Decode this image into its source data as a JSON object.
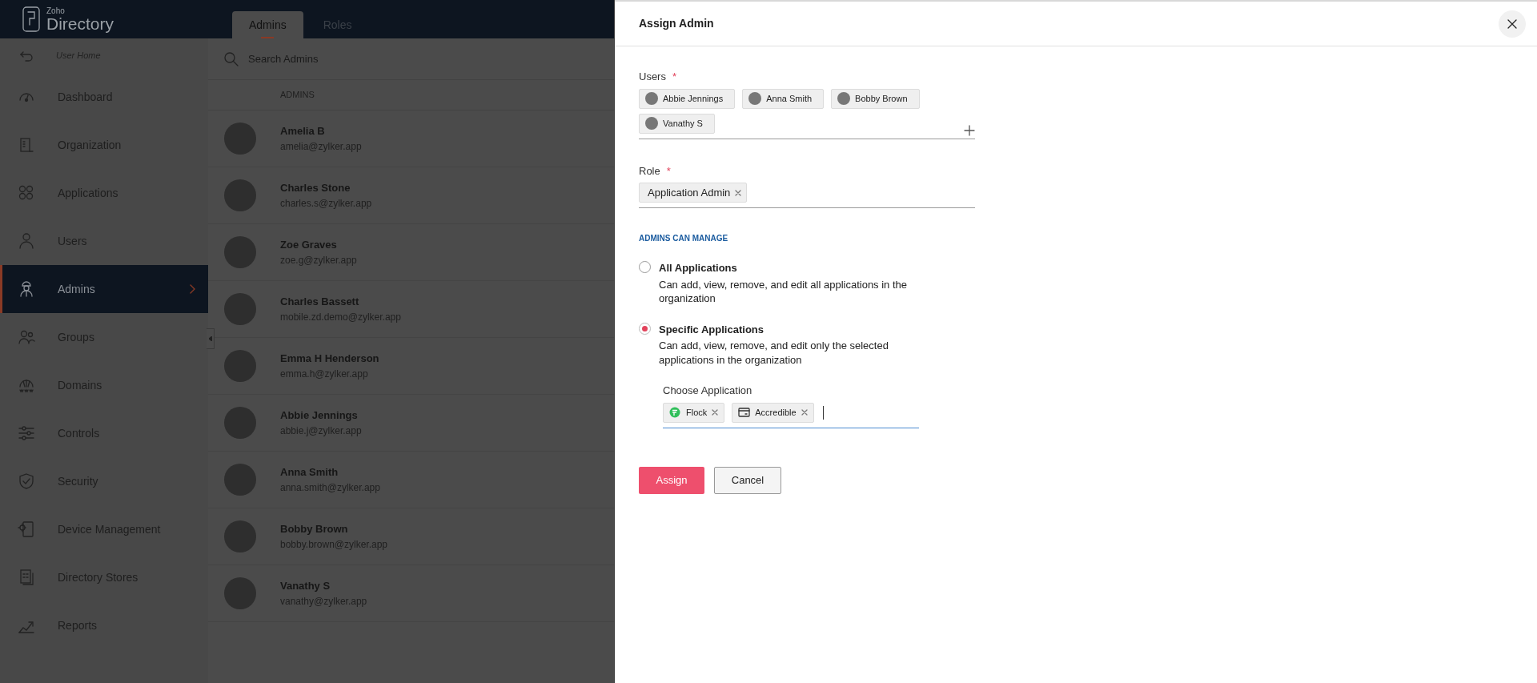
{
  "app": {
    "logo_small": "Zoho",
    "logo_name": "Directory"
  },
  "sidebar": {
    "back": "User Home",
    "items": [
      {
        "label": "Dashboard",
        "kind": "dashboard",
        "selected": false
      },
      {
        "label": "Organization",
        "kind": "organization",
        "selected": false
      },
      {
        "label": "Applications",
        "kind": "applications",
        "selected": false
      },
      {
        "label": "Users",
        "kind": "users",
        "selected": false
      },
      {
        "label": "Admins",
        "kind": "admins",
        "selected": true
      },
      {
        "label": "Groups",
        "kind": "groups",
        "selected": false
      },
      {
        "label": "Domains",
        "kind": "domains",
        "selected": false
      },
      {
        "label": "Controls",
        "kind": "controls",
        "selected": false
      },
      {
        "label": "Security",
        "kind": "security",
        "selected": false
      },
      {
        "label": "Device Management",
        "kind": "devices",
        "selected": false
      },
      {
        "label": "Directory Stores",
        "kind": "stores",
        "selected": false
      },
      {
        "label": "Reports",
        "kind": "reports",
        "selected": false
      }
    ]
  },
  "tabs": [
    {
      "label": "Admins",
      "selected": true
    },
    {
      "label": "Roles",
      "selected": false
    }
  ],
  "search": {
    "placeholder": "Search Admins"
  },
  "table": {
    "column": "ADMINS",
    "rows": [
      {
        "name": "Amelia B",
        "email": "amelia@zylker.app"
      },
      {
        "name": "Charles Stone",
        "email": "charles.s@zylker.app"
      },
      {
        "name": "Zoe Graves",
        "email": "zoe.g@zylker.app"
      },
      {
        "name": "Charles Bassett",
        "email": "mobile.zd.demo@zylker.app"
      },
      {
        "name": "Emma H Henderson",
        "email": "emma.h@zylker.app"
      },
      {
        "name": "Abbie Jennings",
        "email": "abbie.j@zylker.app"
      },
      {
        "name": "Anna Smith",
        "email": "anna.smith@zylker.app"
      },
      {
        "name": "Bobby Brown",
        "email": "bobby.brown@zylker.app"
      },
      {
        "name": "Vanathy S",
        "email": "vanathy@zylker.app"
      }
    ]
  },
  "dialog": {
    "title": "Assign Admin",
    "users": {
      "label": "Users",
      "required_mark": "*",
      "chips": [
        "Abbie Jennings",
        "Anna Smith",
        "Bobby Brown",
        "Vanathy S"
      ]
    },
    "role": {
      "label": "Role",
      "required_mark": "*",
      "chips": [
        "Application Admin"
      ]
    },
    "section": "ADMINS CAN MANAGE",
    "options": [
      {
        "title": "All Applications",
        "description": "Can add, view, remove, and edit all applications in the organization",
        "selected": false
      },
      {
        "title": "Specific Applications",
        "description": "Can add, view, remove, and edit only the selected applications in the organization",
        "selected": true
      }
    ],
    "applications": {
      "label": "Choose Application",
      "chips": [
        {
          "label": "Flock",
          "kind": "flock"
        },
        {
          "label": "Accredible",
          "kind": "accredible"
        }
      ]
    },
    "buttons": [
      {
        "label": "Assign",
        "kind": "primary"
      },
      {
        "label": "Cancel",
        "kind": "secondary"
      }
    ]
  }
}
